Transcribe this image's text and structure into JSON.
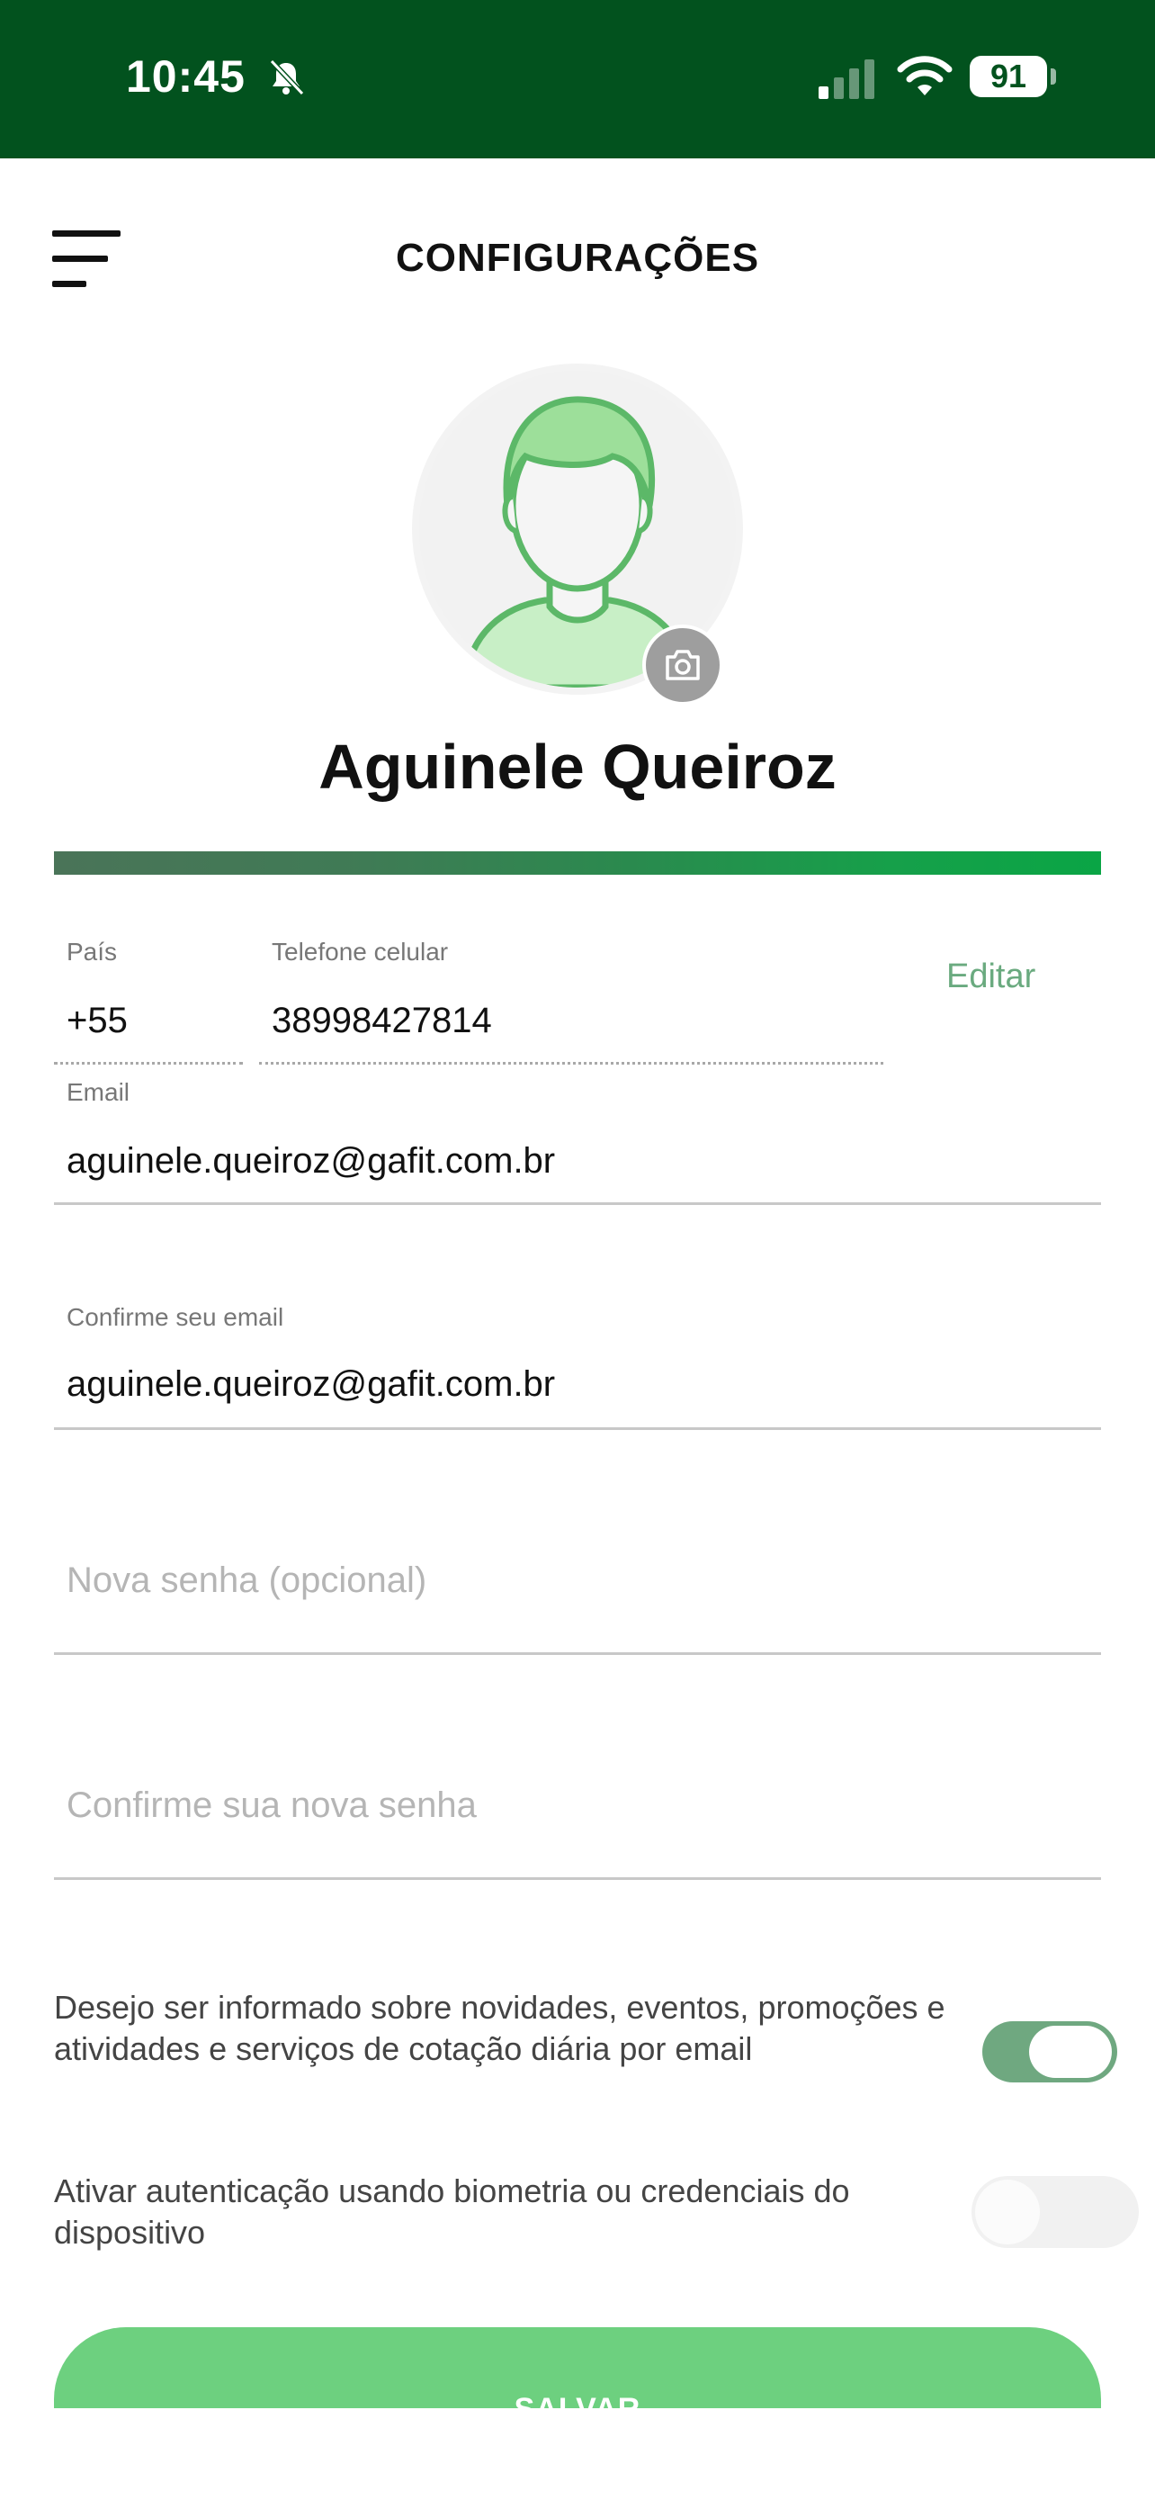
{
  "status_bar": {
    "time": "10:45",
    "battery": "91"
  },
  "header": {
    "title": "CONFIGURAÇÕES"
  },
  "profile": {
    "name": "Aguinele Queiroz"
  },
  "form": {
    "country": {
      "label": "País",
      "value": "+55"
    },
    "phone": {
      "label": "Telefone celular",
      "value": "38998427814"
    },
    "edit_label": "Editar",
    "email": {
      "label": "Email",
      "value": "aguinele.queiroz@gafit.com.br"
    },
    "confirm_email": {
      "label": "Confirme seu email",
      "value": "aguinele.queiroz@gafit.com.br"
    },
    "new_password": {
      "placeholder": "Nova senha (opcional)"
    },
    "confirm_password": {
      "placeholder": "Confirme sua nova senha"
    }
  },
  "options": {
    "newsletter": {
      "text": "Desejo ser informado sobre novidades, eventos, promoções e atividades e serviços de cotação diária por email",
      "enabled": true
    },
    "biometrics": {
      "text": "Ativar autenticação usando biometria ou credenciais do dispositivo",
      "enabled": false
    }
  },
  "actions": {
    "save_label": "SALVAR"
  },
  "colors": {
    "status_bar": "#02521e",
    "accent": "#6aaa7f",
    "save_button": "#6dd07f",
    "avatar_green": "#c8efc6"
  }
}
